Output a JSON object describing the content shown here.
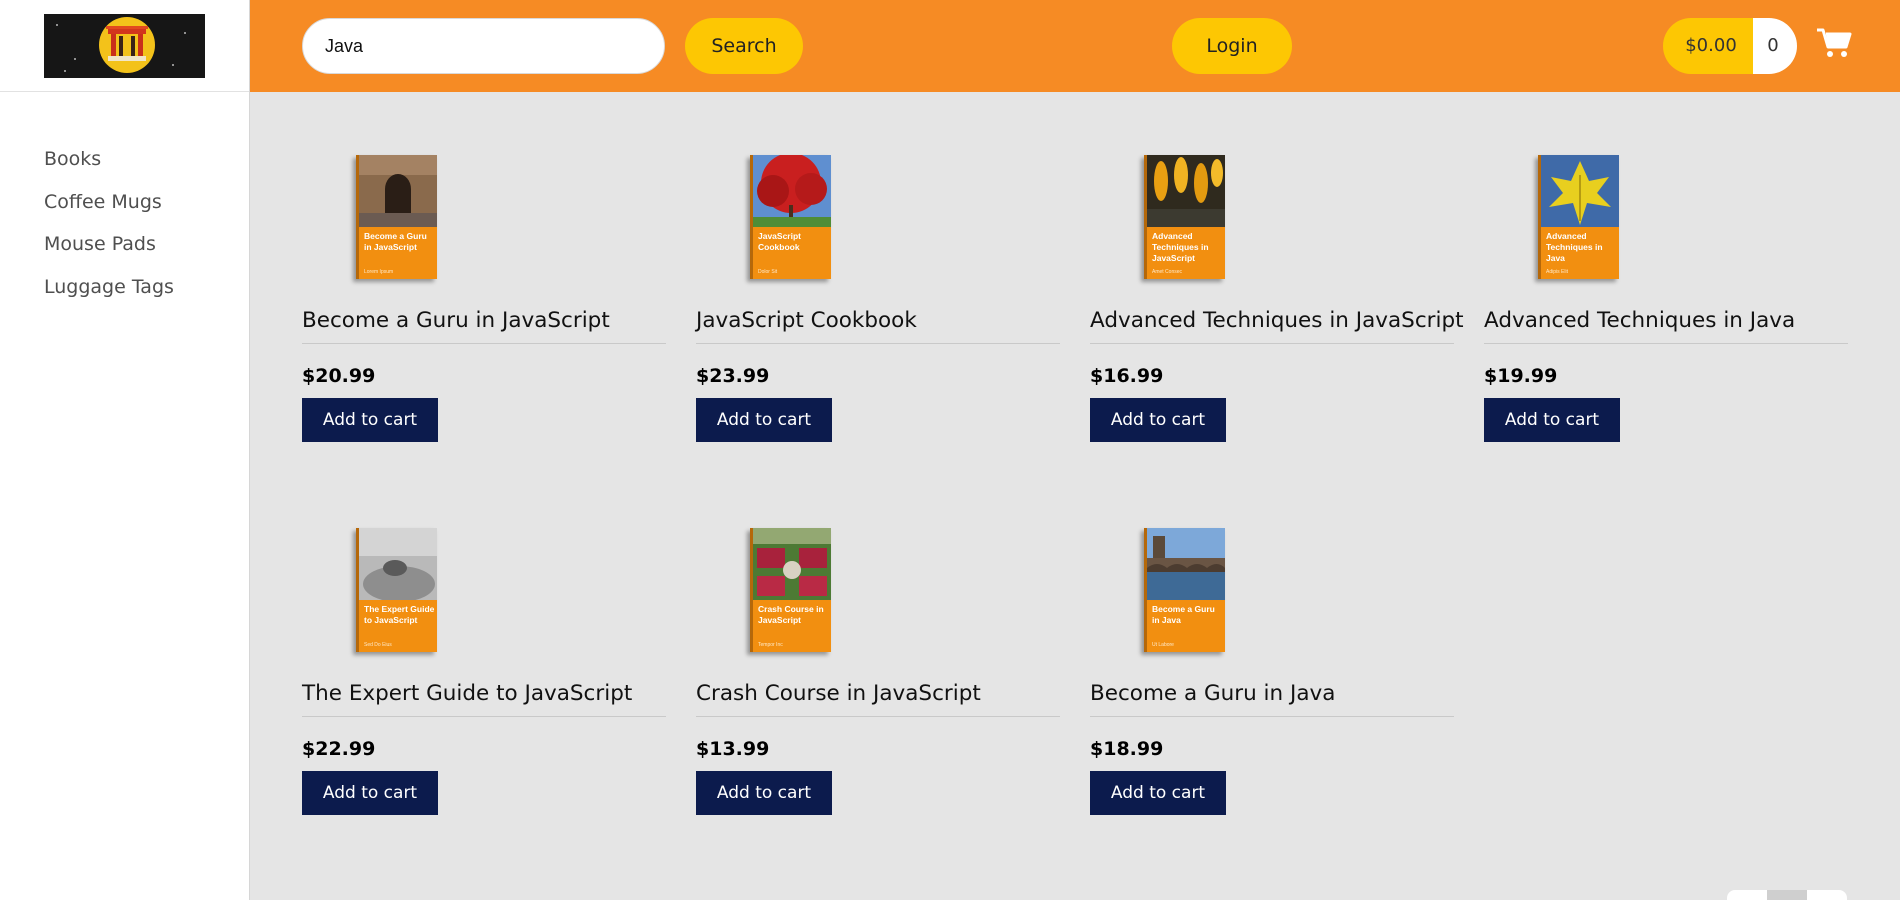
{
  "sidebar": {
    "logo_alt": "site-logo",
    "items": [
      {
        "label": "Books"
      },
      {
        "label": "Coffee Mugs"
      },
      {
        "label": "Mouse Pads"
      },
      {
        "label": "Luggage Tags"
      }
    ]
  },
  "header": {
    "search_value": "Java",
    "search_button": "Search",
    "login_button": "Login",
    "cart_total": "$0.00",
    "cart_count": "0",
    "cart_icon": "shopping-cart-icon"
  },
  "colors": {
    "header": "#f68b24",
    "button_yellow": "#fdc703",
    "add_to_cart": "#0c1b4d",
    "cover_orange": "#f28f10"
  },
  "products": [
    {
      "title": "Become a Guru in JavaScript",
      "price": "$20.99",
      "cover_title": "Become a Guru in JavaScript",
      "cover_author": "Lorem Ipsum",
      "add_label": "Add to cart"
    },
    {
      "title": "JavaScript Cookbook",
      "price": "$23.99",
      "cover_title": "JavaScript Cookbook",
      "cover_author": "Dolor Sit",
      "add_label": "Add to cart"
    },
    {
      "title": "Advanced Techniques in JavaScript",
      "price": "$16.99",
      "cover_title": "Advanced Techniques in JavaScript",
      "cover_author": "Amet Consec",
      "add_label": "Add to cart"
    },
    {
      "title": "Advanced Techniques in Java",
      "price": "$19.99",
      "cover_title": "Advanced Techniques in Java",
      "cover_author": "Adipis Elit",
      "add_label": "Add to cart"
    },
    {
      "title": "The Expert Guide to JavaScript",
      "price": "$22.99",
      "cover_title": "The Expert Guide to JavaScript",
      "cover_author": "Sed Do Eius",
      "add_label": "Add to cart"
    },
    {
      "title": "Crash Course in JavaScript",
      "price": "$13.99",
      "cover_title": "Crash Course in JavaScript",
      "cover_author": "Tempor Inc",
      "add_label": "Add to cart"
    },
    {
      "title": "Become a Guru in Java",
      "price": "$18.99",
      "cover_title": "Become a Guru in Java",
      "cover_author": "Ut Labore",
      "add_label": "Add to cart"
    }
  ]
}
